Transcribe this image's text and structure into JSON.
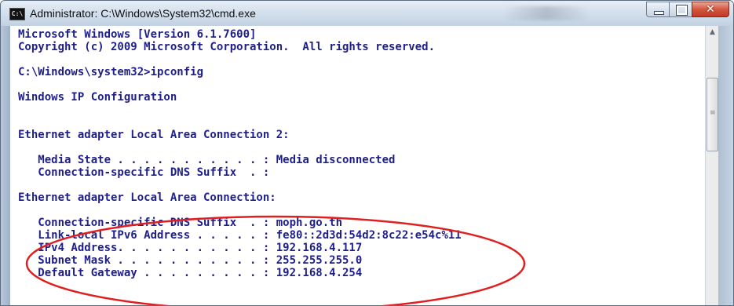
{
  "window": {
    "title": "Administrator: C:\\Windows\\System32\\cmd.exe",
    "app_icon": "cmd-icon",
    "controls": [
      "minimize-icon",
      "maximize-icon",
      "close-icon"
    ]
  },
  "console": {
    "lines": [
      "Microsoft Windows [Version 6.1.7600]",
      "Copyright (c) 2009 Microsoft Corporation.  All rights reserved.",
      "C:\\Windows\\system32>ipconfig",
      "Windows IP Configuration",
      "Ethernet adapter Local Area Connection 2:",
      "   Media State . . . . . . . . . . . : Media disconnected",
      "   Connection-specific DNS Suffix  . :",
      "Ethernet adapter Local Area Connection:",
      "   Connection-specific DNS Suffix  . : moph.go.th",
      "   Link-local IPv6 Address . . . . . : fe80::2d3d:54d2:8c22:e54c%11",
      "   IPv4 Address. . . . . . . . . . . : 192.168.4.117",
      "   Subnet Mask . . . . . . . . . . . : 255.255.255.0",
      "   Default Gateway . . . . . . . . . : 192.168.4.254"
    ],
    "text_color": "#1f1f8a",
    "background": "#ffffff"
  },
  "annotation": {
    "shape": "ellipse",
    "color": "#e02020",
    "encloses": "IPv4 Address / Subnet Mask / Default Gateway lines"
  },
  "scrollbar": {
    "up_arrow": "scroll-up-icon",
    "thumb_grip": "grip-icon"
  }
}
